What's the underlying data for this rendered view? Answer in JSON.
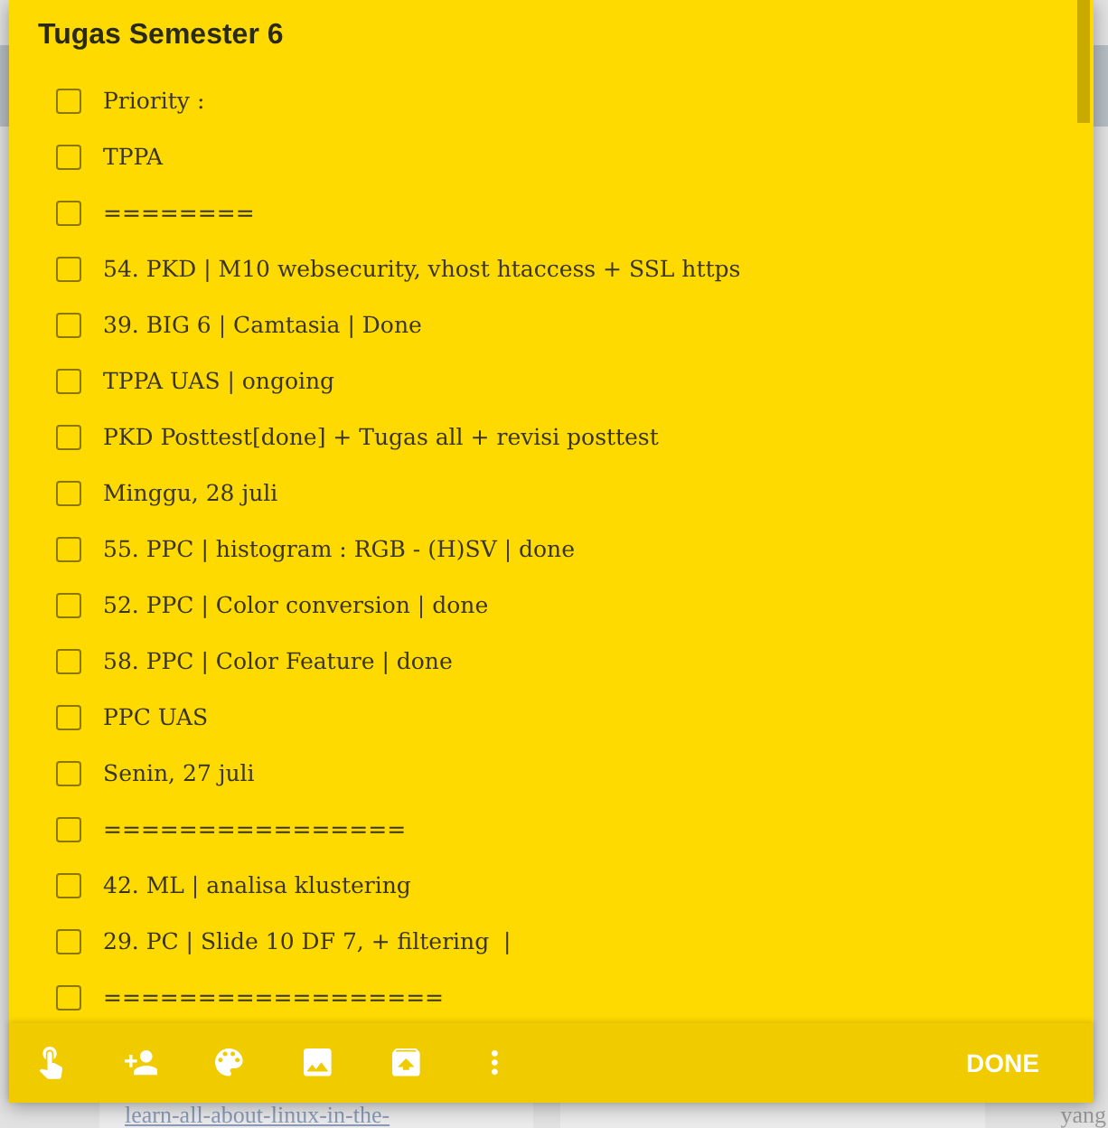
{
  "note": {
    "title": "Tugas Semester 6",
    "items": [
      {
        "text": "Priority :",
        "checked": false
      },
      {
        "text": "TPPA",
        "checked": false
      },
      {
        "text": "========",
        "checked": false
      },
      {
        "text": "54. PKD | M10 websecurity, vhost htaccess + SSL https",
        "checked": false
      },
      {
        "text": "39. BIG 6 | Camtasia | Done",
        "checked": false
      },
      {
        "text": "TPPA UAS | ongoing",
        "checked": false
      },
      {
        "text": "PKD Posttest[done] + Tugas all + revisi posttest",
        "checked": false
      },
      {
        "text": "Minggu, 28 juli",
        "checked": false
      },
      {
        "text": "55. PPC | histogram : RGB - (H)SV | done",
        "checked": false
      },
      {
        "text": "52. PPC | Color conversion | done",
        "checked": false
      },
      {
        "text": "58. PPC | Color Feature | done",
        "checked": false
      },
      {
        "text": "PPC UAS",
        "checked": false
      },
      {
        "text": "Senin, 27 juli",
        "checked": false
      },
      {
        "text": "================",
        "checked": false
      },
      {
        "text": "42. ML | analisa klustering",
        "checked": false
      },
      {
        "text": "29. PC | Slide 10 DF 7, + filtering  |",
        "checked": false
      },
      {
        "text": "==================",
        "checked": false
      }
    ],
    "done_button": "DONE"
  },
  "background": {
    "link": "learn-all-about-linux-in-the-",
    "text_fragment": "yang"
  }
}
